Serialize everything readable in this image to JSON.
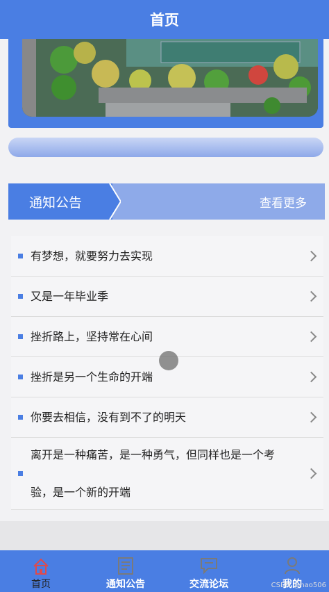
{
  "header": {
    "title": "首页"
  },
  "section": {
    "title": "通知公告",
    "more": "查看更多"
  },
  "notices": [
    {
      "text": "有梦想，就要努力去实现"
    },
    {
      "text": "又是一年毕业季"
    },
    {
      "text": "挫折路上，坚持常在心间"
    },
    {
      "text": "挫折是另一个生命的开端"
    },
    {
      "text": "你要去相信，没有到不了的明天"
    },
    {
      "text": "离开是一种痛苦，是一种勇气，但同样也是一个考验，是一个新的开端"
    }
  ],
  "tabbar": [
    {
      "label": "首页",
      "icon": "home-icon"
    },
    {
      "label": "通知公告",
      "icon": "notice-icon"
    },
    {
      "label": "交流论坛",
      "icon": "forum-icon"
    },
    {
      "label": "我的",
      "icon": "user-icon"
    }
  ],
  "watermark": "CSDN @hao506",
  "colors": {
    "primary": "#4a7ee3",
    "secondary": "#8eaae9",
    "active_tab": "#e04a4a"
  }
}
